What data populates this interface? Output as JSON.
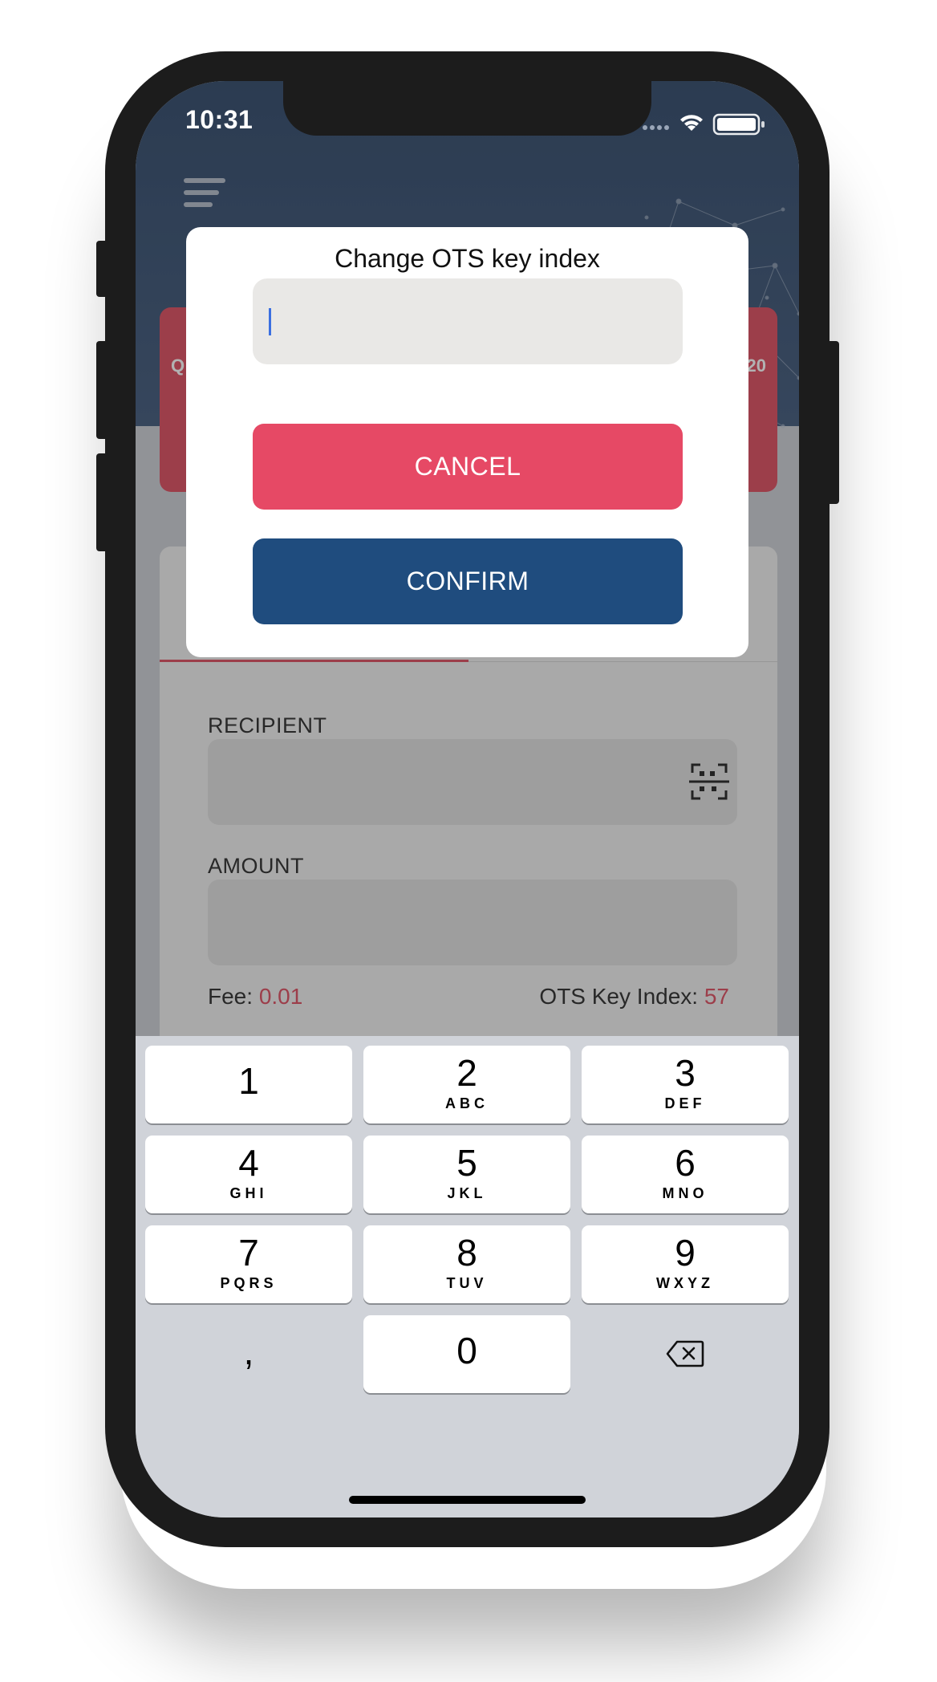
{
  "status_bar": {
    "time": "10:31"
  },
  "card": {
    "left_edge_text": "Q",
    "right_edge_text": "20"
  },
  "form": {
    "recipient_label": "RECIPIENT",
    "recipient_value": "",
    "amount_label": "AMOUNT",
    "amount_value": "",
    "fee_label": "Fee:",
    "fee_value": "0.01",
    "ots_label": "OTS Key Index:",
    "ots_value": "57"
  },
  "dialog": {
    "title": "Change OTS key index",
    "input_value": "",
    "cancel_label": "CANCEL",
    "confirm_label": "CONFIRM"
  },
  "keyboard": {
    "keys": [
      {
        "num": "1",
        "letters": ""
      },
      {
        "num": "2",
        "letters": "ABC"
      },
      {
        "num": "3",
        "letters": "DEF"
      },
      {
        "num": "4",
        "letters": "GHI"
      },
      {
        "num": "5",
        "letters": "JKL"
      },
      {
        "num": "6",
        "letters": "MNO"
      },
      {
        "num": "7",
        "letters": "PQRS"
      },
      {
        "num": "8",
        "letters": "TUV"
      },
      {
        "num": "9",
        "letters": "WXYZ"
      }
    ],
    "comma": ",",
    "zero": "0",
    "backspace_icon": "backspace-icon"
  },
  "colors": {
    "header": "#3f5675",
    "accent_red": "#e64965",
    "confirm_blue": "#1f4c7e"
  }
}
